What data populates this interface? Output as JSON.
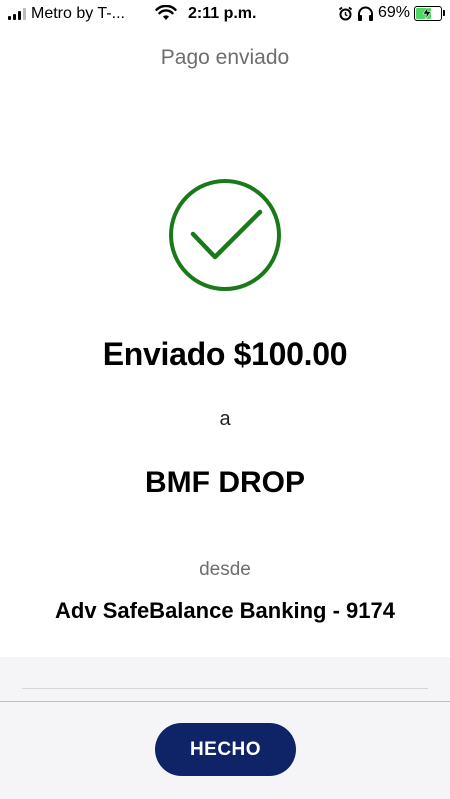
{
  "status_bar": {
    "carrier": "Metro by T-...",
    "time": "2:11 p.m.",
    "battery_percent": "69%",
    "battery_level": 0.69,
    "icons": [
      "signal-icon",
      "wifi-icon",
      "alarm-icon",
      "headphones-icon",
      "battery-charging-icon"
    ]
  },
  "header": {
    "title": "Pago enviado"
  },
  "confirmation": {
    "icon": "checkmark-circle-icon",
    "icon_color": "#1a7a1a",
    "amount_line": "Enviado $100.00",
    "to_label": "a",
    "recipient": "BMF DROP",
    "from_label": "desde",
    "account": "Adv SafeBalance Banking - 9174"
  },
  "footer": {
    "done_label": "HECHO",
    "button_color": "#0f2466"
  }
}
